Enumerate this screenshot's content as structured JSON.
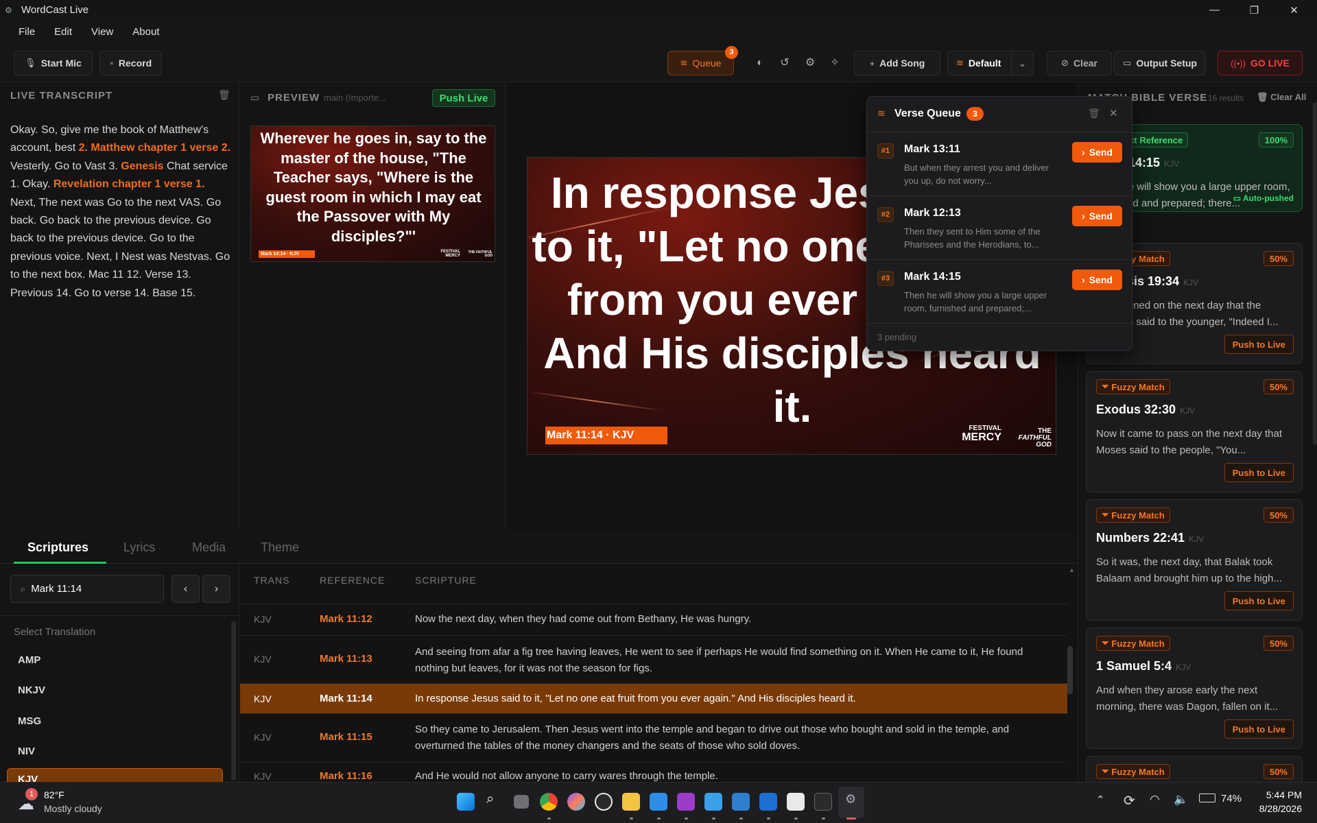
{
  "window": {
    "title": "WordCast Live",
    "minimize": "—",
    "maximize": "❐",
    "close": "✕"
  },
  "menu": [
    "File",
    "Edit",
    "View",
    "About"
  ],
  "toolbar": {
    "start_mic": "Start Mic",
    "record": "Record",
    "queue": "Queue",
    "queue_count": "3",
    "add_song": "Add Song",
    "default": "Default",
    "clear": "Clear",
    "output_setup": "Output Setup",
    "go_live": "GO LIVE"
  },
  "transcript": {
    "title": "LIVE TRANSCRIPT",
    "segments": [
      {
        "t": "Okay. So, give me the book of Matthew's account, best ",
        "hl": false
      },
      {
        "t": "2. Matthew chapter 1 verse 2.",
        "hl": true
      },
      {
        "t": " Vesterly. Go to Vast 3. ",
        "hl": false
      },
      {
        "t": "Genesis",
        "hl": true
      },
      {
        "t": " Chat service 1. Okay. ",
        "hl": false
      },
      {
        "t": "Revelation chapter 1 verse 1.",
        "hl": true
      },
      {
        "t": " Next, The next was Go to the next VAS. Go back. Go back to the previous device. Go back to the previous device. Go to the previous voice. Next, I Nest was Nestvas. Go to the next box. Mac 11 12. Verse 13. Previous 14. Go to verse 14. Base 15.",
        "hl": false
      }
    ]
  },
  "preview": {
    "title": "PREVIEW",
    "subtitle": "main (Importe...",
    "push_live": "Push Live",
    "slide_text": "Wherever he goes in, say to the master of the house, \"The Teacher says, \"Where is the guest room in which I may eat the Passover with My disciples?\"'",
    "slide_ref": "Mark 14:14 · KJV",
    "logo_a": "FESTIVAL MERCY",
    "logo_b": "THE FAITHFUL GOD"
  },
  "live": {
    "text": "In response Jesus said to it, \"Let no one eat fruit from you ever again.\" And His disciples heard it.",
    "ref": "Mark 11:14 · KJV",
    "logo_a1": "FESTIVAL",
    "logo_a2": "MERCY",
    "logo_b1": "THE",
    "logo_b2": "FAITHFUL GOD"
  },
  "match_panel": {
    "title": "MATCH BIBLE VERSE",
    "count": "16 results",
    "clear_all": "Clear All",
    "cards": [
      {
        "badge": "Direct Reference",
        "pct": "100%",
        "ref": "Mark 14:15",
        "ver": "KJV",
        "snip": "Then he will show you a large upper room, furnished and prepared; there...",
        "action": "Auto-pushed"
      },
      {
        "badge": "Fuzzy Match",
        "pct": "50%",
        "ref": "Genesis 19:34",
        "ver": "KJV",
        "snip": "It happened on the next day that the firstborn said to the younger, \"Indeed I...",
        "action": "Push to Live"
      },
      {
        "badge": "Fuzzy Match",
        "pct": "50%",
        "ref": "Exodus 32:30",
        "ver": "KJV",
        "snip": "Now it came to pass on the next day that Moses said to the people, \"You...",
        "action": "Push to Live"
      },
      {
        "badge": "Fuzzy Match",
        "pct": "50%",
        "ref": "Numbers 22:41",
        "ver": "KJV",
        "snip": "So it was, the next day, that Balak took Balaam and brought him up to the high...",
        "action": "Push to Live"
      },
      {
        "badge": "Fuzzy Match",
        "pct": "50%",
        "ref": "1 Samuel 5:4",
        "ver": "KJV",
        "snip": "And when they arose early the next morning, there was Dagon, fallen on it...",
        "action": "Push to Live"
      },
      {
        "badge": "Fuzzy Match",
        "pct": "50%",
        "ref": "",
        "ver": "",
        "snip": "",
        "action": ""
      }
    ]
  },
  "queue": {
    "title": "Verse Queue",
    "count": "3",
    "footer": "3 pending",
    "items": [
      {
        "num": "#1",
        "ref": "Mark 13:11",
        "snip": "But when they arrest you and deliver you up, do not worry...",
        "send": "Send"
      },
      {
        "num": "#2",
        "ref": "Mark 12:13",
        "snip": "Then they sent to Him some of the Pharisees and the Herodians, to...",
        "send": "Send"
      },
      {
        "num": "#3",
        "ref": "Mark 14:15",
        "snip": "Then he will show you a large upper room, furnished and prepared;...",
        "send": "Send"
      }
    ]
  },
  "tabs": [
    "Scriptures",
    "Lyrics",
    "Media",
    "Theme"
  ],
  "search": {
    "value": "Mark 11:14"
  },
  "translations": {
    "title": "Select Translation",
    "items": [
      "AMP",
      "NKJV",
      "MSG",
      "NIV",
      "KJV"
    ]
  },
  "table": {
    "headers": [
      "TRANS",
      "REFERENCE",
      "SCRIPTURE"
    ],
    "rows": [
      {
        "trans": "KJV",
        "ref": "Mark 11:12",
        "text": "Now the next day, when they had come out from Bethany, He was hungry."
      },
      {
        "trans": "KJV",
        "ref": "Mark 11:13",
        "text": "And seeing from afar a fig tree having leaves, He went to see if perhaps He would find something on it. When He came to it, He found nothing but leaves, for it was not the season for figs."
      },
      {
        "trans": "KJV",
        "ref": "Mark 11:14",
        "text": "In response Jesus said to it, \"Let no one eat fruit from you ever again.\" And His disciples heard it."
      },
      {
        "trans": "KJV",
        "ref": "Mark 11:15",
        "text": "So they came to Jerusalem. Then Jesus went into the temple and began to drive out those who bought and sold in the temple, and overturned the tables of the money changers and the seats of those who sold doves."
      },
      {
        "trans": "KJV",
        "ref": "Mark 11:16",
        "text": "And He would not allow anyone to carry wares through the temple."
      }
    ]
  },
  "taskbar": {
    "weather_badge": "1",
    "temp": "82°F",
    "condition": "Mostly cloudy",
    "battery": "74%",
    "time": "5:44 PM",
    "date": "8/28/2026"
  },
  "colors": {
    "accent": "#f05a0c",
    "accent_text": "#f2782a",
    "green": "#22c55e",
    "go_live": "#ef4444"
  }
}
